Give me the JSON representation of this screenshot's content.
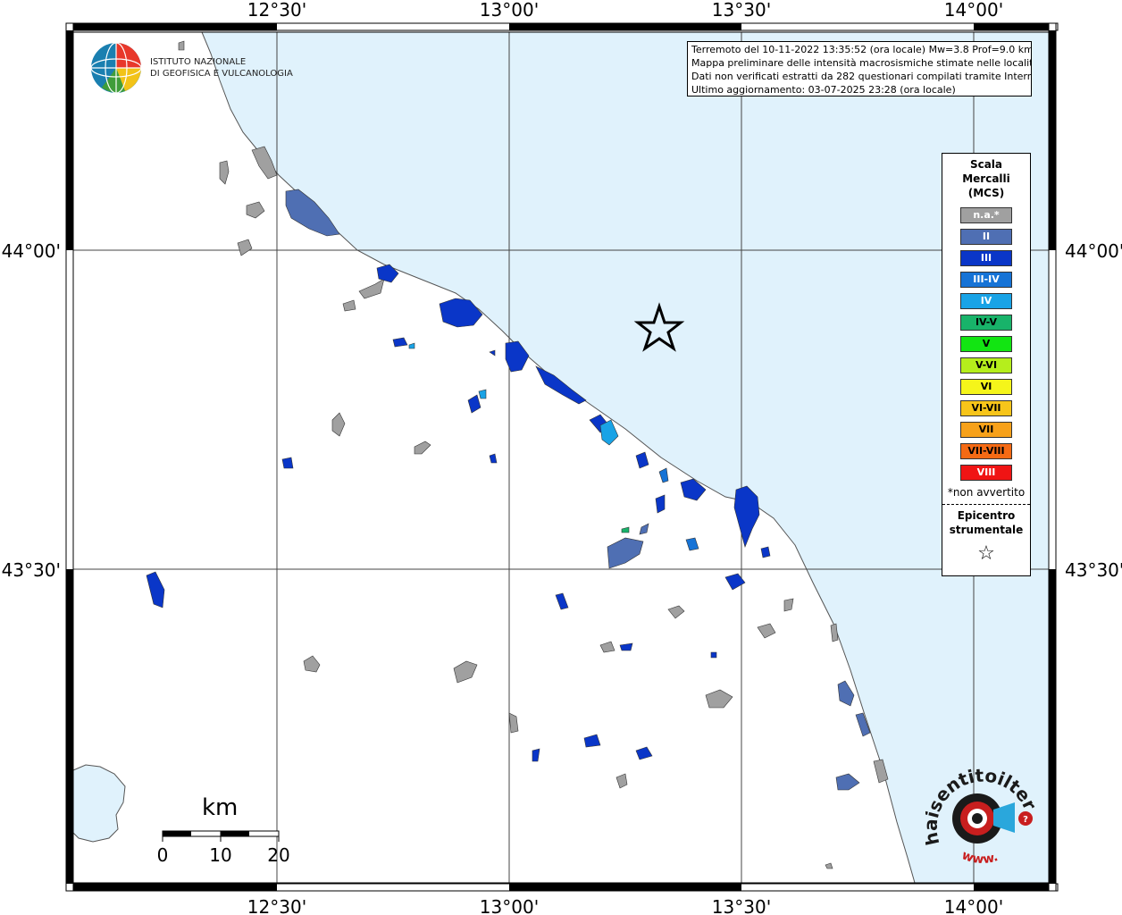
{
  "axes": {
    "top_ticks": [
      "12°30'",
      "13°00'",
      "13°30'",
      "14°00'"
    ],
    "bottom_ticks": [
      "12°30'",
      "13°00'",
      "13°30'",
      "14°00'"
    ],
    "left_ticks": [
      "44°00'",
      "43°30'"
    ],
    "right_ticks": [
      "44°00'",
      "43°30'"
    ]
  },
  "info": {
    "line1": "Terremoto del 10-11-2022 13:35:52 (ora locale) Mw=3.8 Prof=9.0 km",
    "line2": "Mappa preliminare delle intensità macrosismiche stimate nelle località",
    "line3": "Dati non verificati estratti da 282 questionari compilati tramite Internet.",
    "line4": "Ultimo aggiornamento: 03-07-2025 23:28 (ora locale)"
  },
  "institute": {
    "line1": "ISTITUTO NAZIONALE",
    "line2": "DI GEOFISICA E VULCANOLOGIA"
  },
  "legend": {
    "title1": "Scala",
    "title2": "Mercalli",
    "title3": "(MCS)",
    "items": [
      {
        "label": "n.a.*",
        "color": "#a0a0a0",
        "text_color": "#ffffff"
      },
      {
        "label": "II",
        "color": "#4f6fb3",
        "text_color": "#ffffff"
      },
      {
        "label": "III",
        "color": "#0a36c8",
        "text_color": "#ffffff"
      },
      {
        "label": "III-IV",
        "color": "#1673d6",
        "text_color": "#ffffff"
      },
      {
        "label": "IV",
        "color": "#19a3e6",
        "text_color": "#ffffff"
      },
      {
        "label": "IV-V",
        "color": "#18b36a",
        "text_color": "#000000"
      },
      {
        "label": "V",
        "color": "#12e512",
        "text_color": "#000000"
      },
      {
        "label": "V-VI",
        "color": "#b5ee1c",
        "text_color": "#000000"
      },
      {
        "label": "VI",
        "color": "#f5f51a",
        "text_color": "#000000"
      },
      {
        "label": "VI-VII",
        "color": "#f7c51a",
        "text_color": "#000000"
      },
      {
        "label": "VII",
        "color": "#f7a11a",
        "text_color": "#000000"
      },
      {
        "label": "VII-VIII",
        "color": "#f56a14",
        "text_color": "#000000"
      },
      {
        "label": "VIII",
        "color": "#f01414",
        "text_color": "#ffffff"
      }
    ],
    "note": "*non avvertito",
    "epi1": "Epicentro",
    "epi2": "strumentale",
    "epi_symbol": "☆"
  },
  "scale_bar": {
    "unit": "km",
    "labels": [
      "0",
      "10",
      "20"
    ]
  },
  "hs_logo": {
    "text": "haisentitoilterremoto.it",
    "sub": "www."
  },
  "colors": {
    "sea": "#e0f2fc",
    "land": "#ffffff"
  }
}
